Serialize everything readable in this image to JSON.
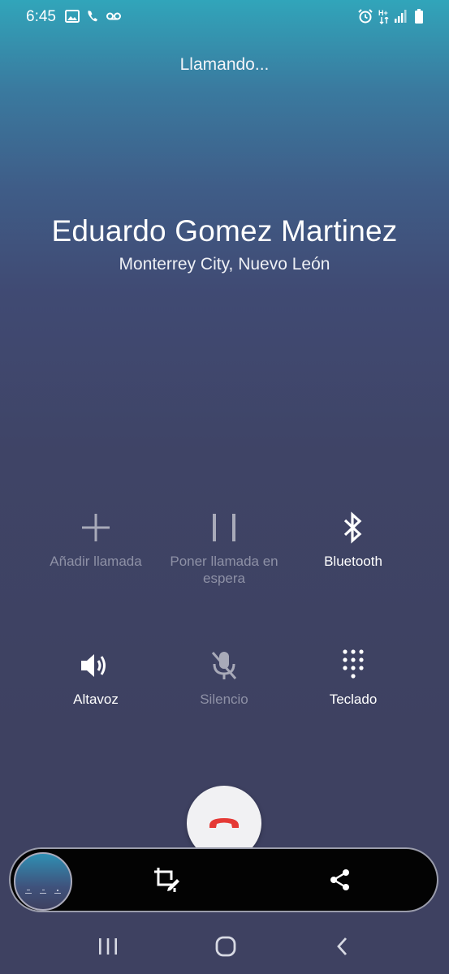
{
  "status_bar": {
    "time": "6:45",
    "left_icons": [
      "image-icon",
      "phone-icon",
      "voicemail-icon"
    ],
    "right_icons": [
      "alarm-icon",
      "network-hplus-icon",
      "signal-icon",
      "battery-icon"
    ],
    "network_label": "H+"
  },
  "call": {
    "status": "Llamando...",
    "contact_name": "Eduardo Gomez Martinez",
    "location": "Monterrey City, Nuevo León"
  },
  "controls": [
    {
      "label": "Añadir llamada",
      "icon": "plus-icon",
      "enabled": false
    },
    {
      "label": "Poner llamada en espera",
      "icon": "pause-icon",
      "enabled": false
    },
    {
      "label": "Bluetooth",
      "icon": "bluetooth-icon",
      "enabled": true
    },
    {
      "label": "Altavoz",
      "icon": "speaker-icon",
      "enabled": true
    },
    {
      "label": "Silencio",
      "icon": "mic-off-icon",
      "enabled": false
    },
    {
      "label": "Teclado",
      "icon": "keypad-icon",
      "enabled": true
    }
  ],
  "end_call": {
    "icon": "hang-up-icon",
    "color": "#e53935"
  },
  "screenshot_toolbar": {
    "icons": [
      "screenshot-thumbnail",
      "crop-edit-icon",
      "share-icon"
    ]
  },
  "nav_bar": {
    "icons": [
      "recents-icon",
      "home-icon",
      "back-icon"
    ]
  }
}
